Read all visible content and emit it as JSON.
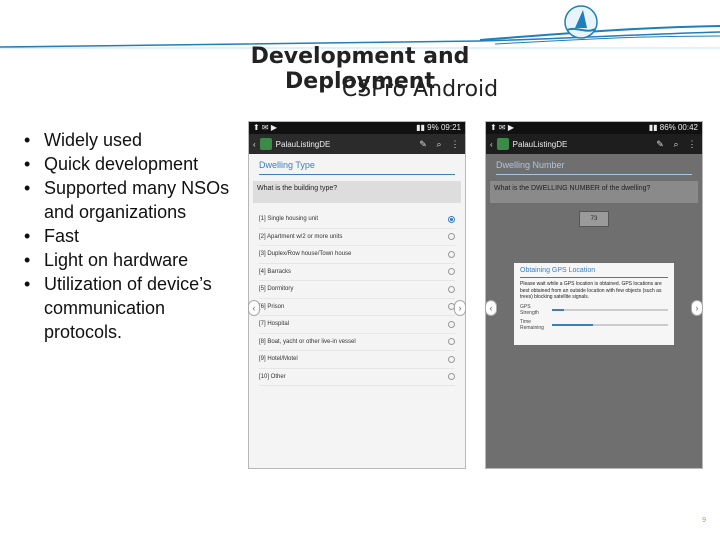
{
  "slide": {
    "title": "Development and Deployment",
    "subtitle": "CSPro Android",
    "page_number": "9"
  },
  "bullets": [
    "Widely used",
    "Quick development",
    "Supported many NSOs and organizations",
    "Fast",
    "Light on hardware",
    "Utilization of device’s communication protocols."
  ],
  "phone1": {
    "status_left": "⬆ ✉ ▶",
    "status_right": "▮▮ 9% 09:21",
    "app_title": "PalauListingDE",
    "section_title": "Dwelling Type",
    "question": "What is the building type?",
    "options": [
      {
        "label": "[1] Single housing unit",
        "selected": true
      },
      {
        "label": "[2] Apartment w/2 or more units",
        "selected": false
      },
      {
        "label": "[3] Duplex/Row house/Town house",
        "selected": false
      },
      {
        "label": "[4] Barracks",
        "selected": false
      },
      {
        "label": "[5] Dormitory",
        "selected": false
      },
      {
        "label": "[6] Prison",
        "selected": false
      },
      {
        "label": "[7] Hospital",
        "selected": false
      },
      {
        "label": "[8] Boat, yacht or other live-in vessel",
        "selected": false
      },
      {
        "label": "[9] Hotel/Motel",
        "selected": false
      },
      {
        "label": "[10] Other",
        "selected": false
      }
    ]
  },
  "phone2": {
    "status_left": "⬆ ✉ ▶",
    "status_right": "▮▮ 86% 00:42",
    "app_title": "PalauListingDE",
    "section_title": "Dwelling Number",
    "question": "What is the DWELLING NUMBER of the dwelling?",
    "answer": "73",
    "dialog_title": "Obtaining GPS Location",
    "dialog_text": "Please wait while a GPS location is obtained. GPS locations are best obtained from an outside location with few objects (such as trees) blocking satellite signals.",
    "gps_strength_label": "GPS Strength",
    "time_remaining_label": "Time Remaining",
    "gps_strength_level": 0.1,
    "time_remaining_level": 0.35
  },
  "colors": {
    "accent": "#3a7fc0",
    "wave": "#1f7fb8",
    "page_number": "#c49b2a"
  }
}
